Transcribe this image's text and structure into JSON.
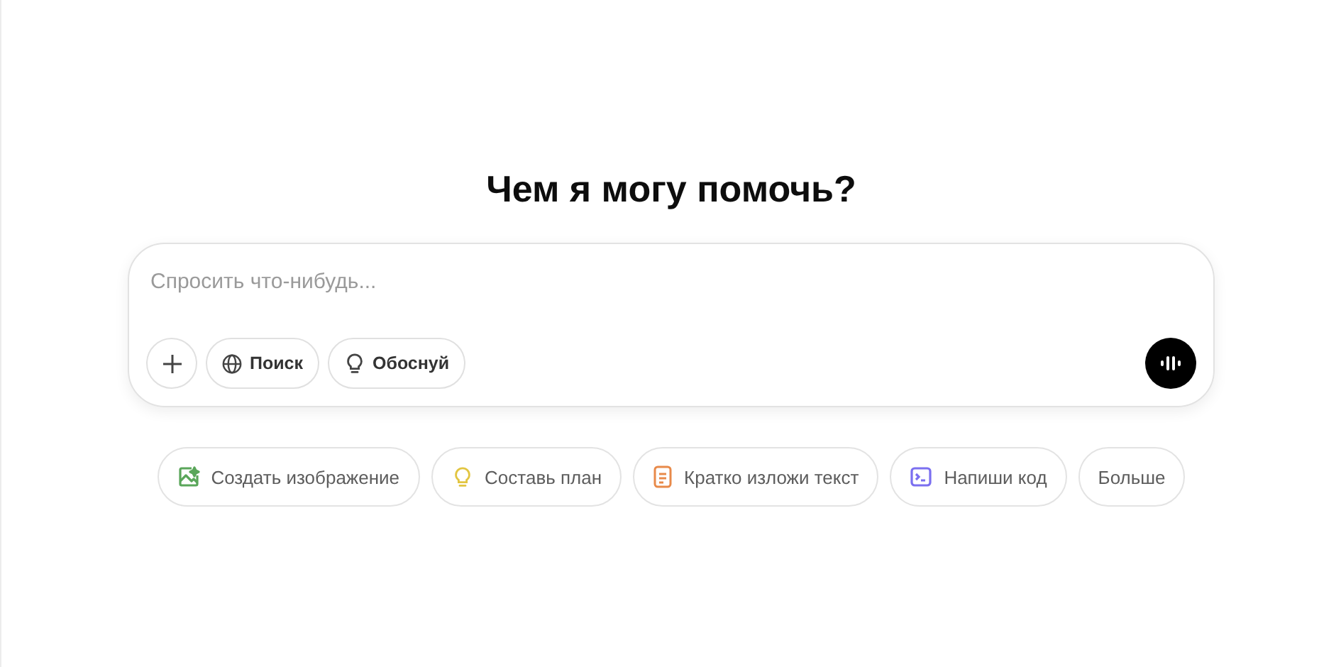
{
  "heading": "Чем я могу помочь?",
  "composer": {
    "placeholder": "Спросить что-нибудь...",
    "tools": [
      {
        "kind": "attach"
      },
      {
        "kind": "search",
        "label": "Поиск"
      },
      {
        "kind": "reason",
        "label": "Обоснуй"
      }
    ]
  },
  "suggestions": [
    {
      "kind": "image",
      "label": "Создать изображение",
      "color": "#5aa65a"
    },
    {
      "kind": "idea",
      "label": "Составь план",
      "color": "#e2c541"
    },
    {
      "kind": "document",
      "label": "Кратко изложи текст",
      "color": "#e88a4a"
    },
    {
      "kind": "code",
      "label": "Напиши код",
      "color": "#7b6ff0"
    },
    {
      "kind": "plain",
      "label": "Больше"
    }
  ]
}
